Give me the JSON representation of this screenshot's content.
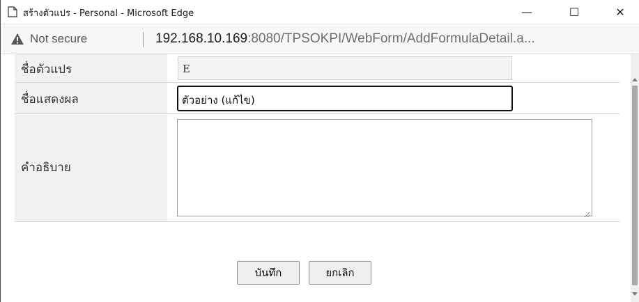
{
  "window": {
    "title": "สร้างตัวแปร - Personal - Microsoft Edge",
    "minimize_symbol": "—",
    "maximize_symbol": "☐",
    "close_symbol": "✕"
  },
  "address_bar": {
    "security_label": "Not secure",
    "url_host": "192.168.10.169",
    "url_rest": ":8080/TPSOKPI/WebForm/AddFormulaDetail.a..."
  },
  "form": {
    "variable_name_label": "ชื่อตัวแปร",
    "variable_name_value": "E",
    "display_name_label": "ชื่อแสดงผล",
    "display_name_value": "ตัวอย่าง (แก้ไข)",
    "description_label": "คำอธิบาย",
    "description_value": ""
  },
  "buttons": {
    "save_label": "บันทึก",
    "cancel_label": "ยกเลิก"
  },
  "icons": {
    "page": "page-icon",
    "warning": "warning-icon",
    "resize": "resize-grip-icon"
  },
  "colors": {
    "label_bg": "#f1f1f1",
    "readonly_bg": "#f3f3f3",
    "button_bg": "#efefef",
    "focus_border": "#111111"
  }
}
